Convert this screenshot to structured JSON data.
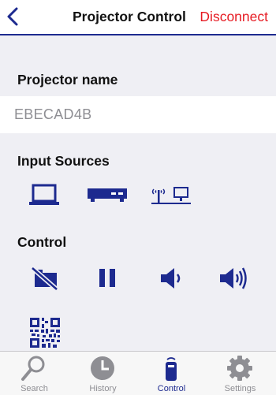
{
  "nav": {
    "title": "Projector Control",
    "disconnect_label": "Disconnect"
  },
  "projector_name": {
    "header": "Projector name",
    "value": "EBECAD4B"
  },
  "input_sources": {
    "header": "Input Sources",
    "items": [
      {
        "icon": "laptop-icon"
      },
      {
        "icon": "video-device-icon"
      },
      {
        "icon": "network-icon"
      }
    ]
  },
  "control": {
    "header": "Control",
    "items": [
      {
        "icon": "av-mute-icon"
      },
      {
        "icon": "pause-icon"
      },
      {
        "icon": "volume-down-icon"
      },
      {
        "icon": "volume-up-icon"
      },
      {
        "icon": "qr-code-icon"
      }
    ]
  },
  "tabbar": {
    "tabs": [
      {
        "label": "Search",
        "icon": "search-icon",
        "active": false
      },
      {
        "label": "History",
        "icon": "clock-icon",
        "active": false
      },
      {
        "label": "Control",
        "icon": "remote-icon",
        "active": true
      },
      {
        "label": "Settings",
        "icon": "gear-icon",
        "active": false
      }
    ]
  },
  "colors": {
    "accent": "#1d2a8f",
    "destructive": "#e61b23",
    "background": "#efeff4",
    "inactive_tab": "#8e8e93"
  }
}
